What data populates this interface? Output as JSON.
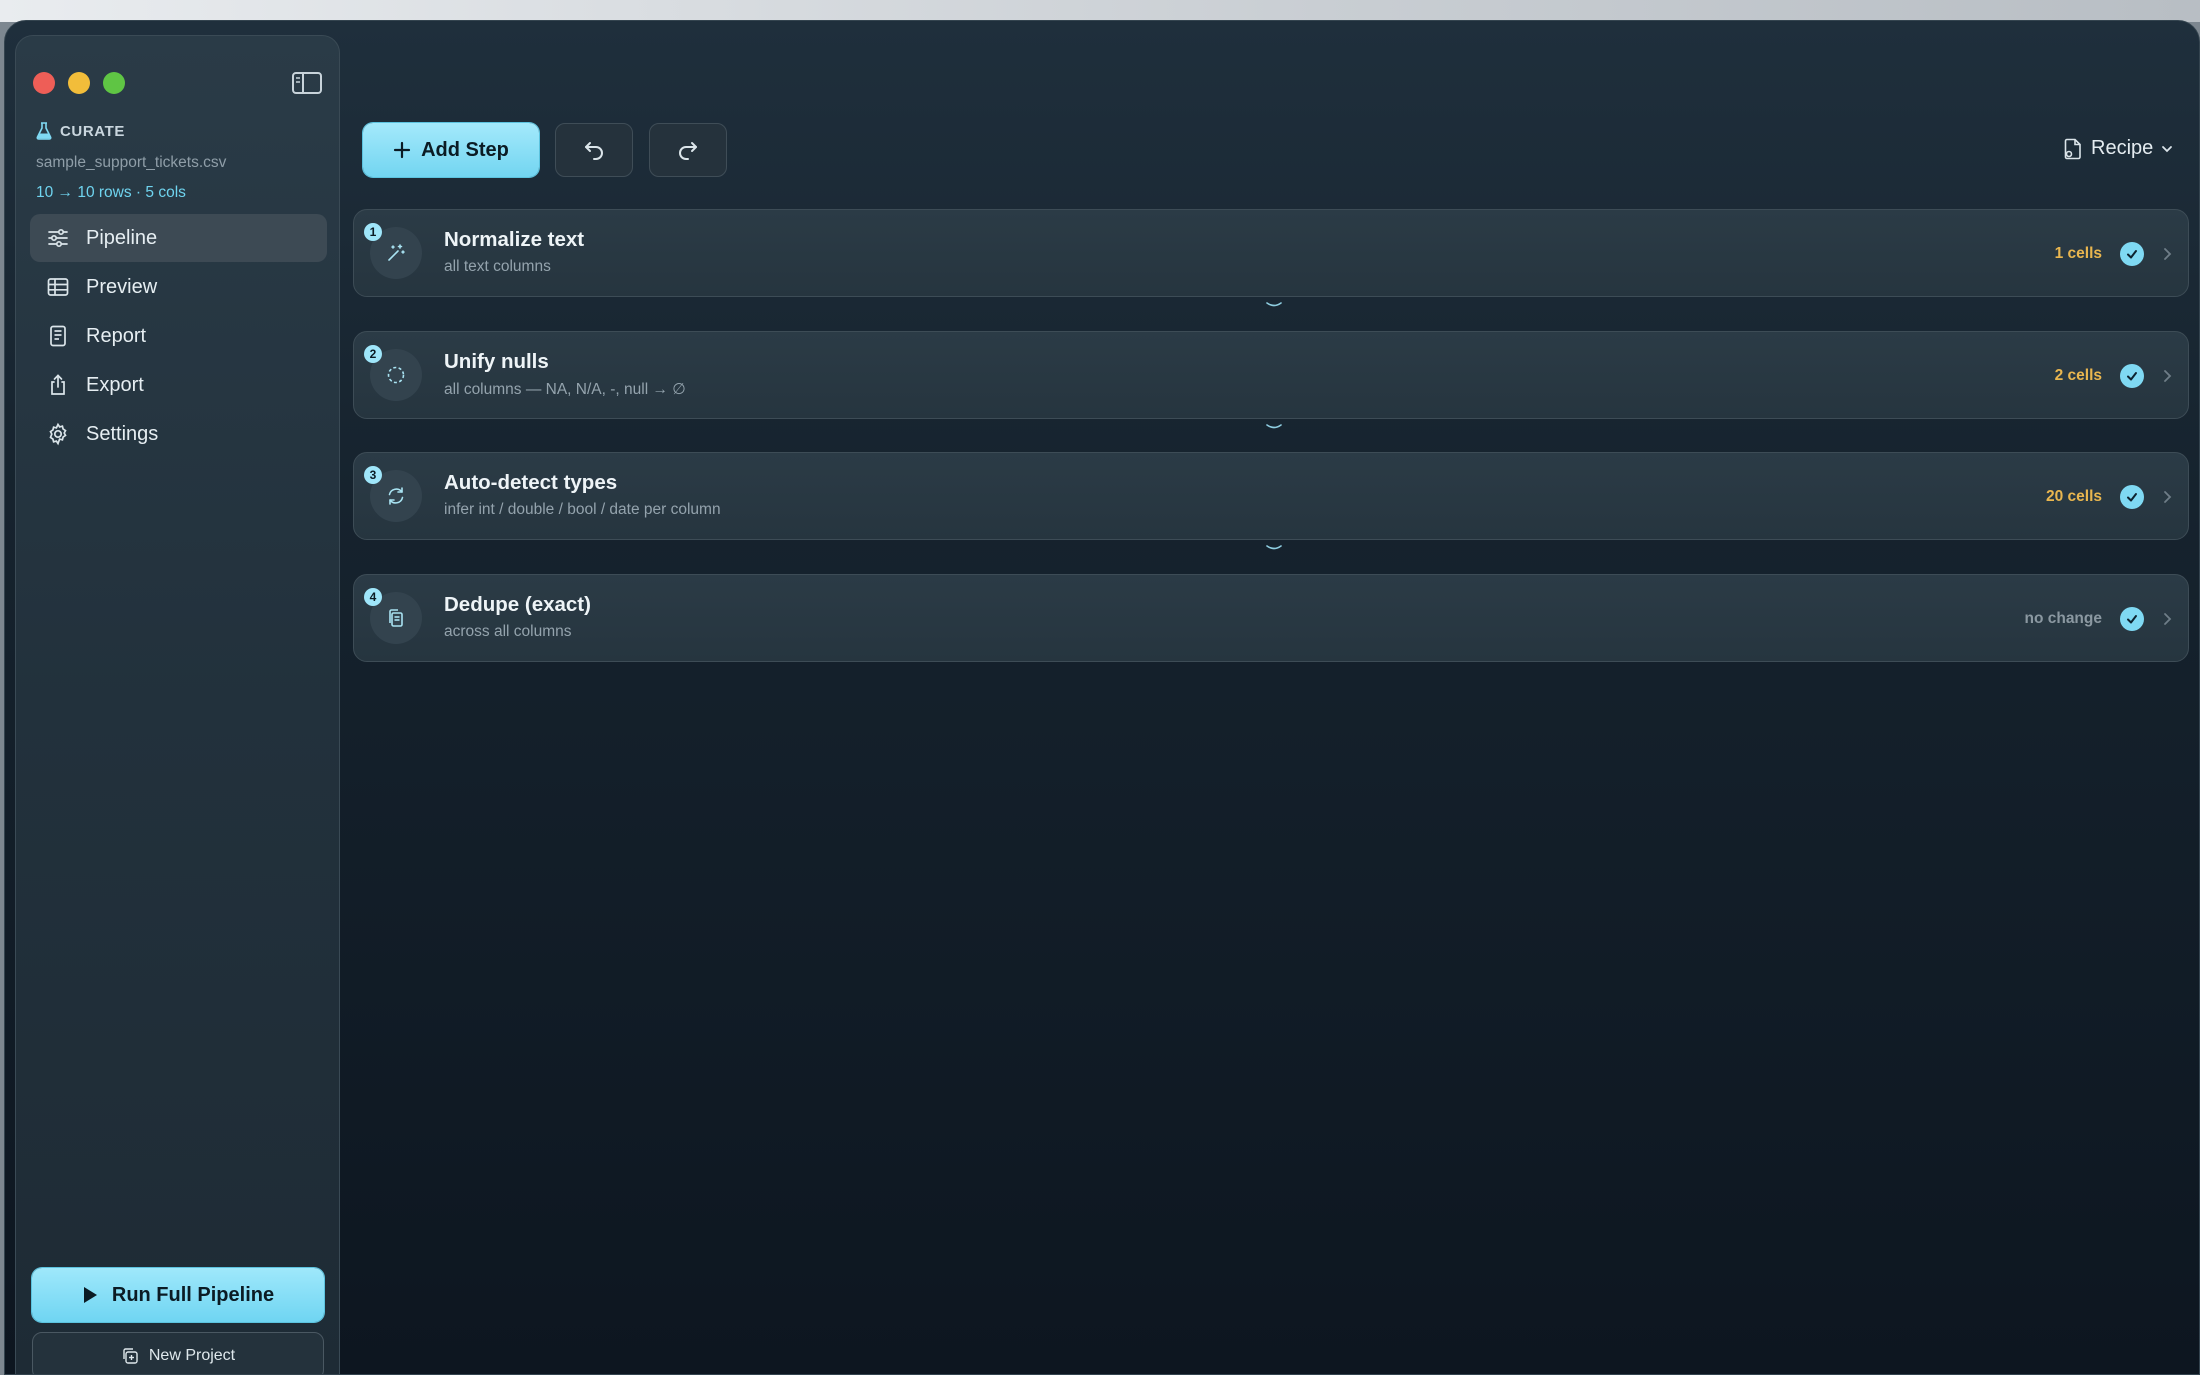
{
  "app": {
    "brand": "CURATE",
    "file_name": "sample_support_tickets.csv",
    "file_stats": "10 → 10 rows · 5 cols"
  },
  "sidebar": {
    "items": [
      {
        "label": "Pipeline",
        "icon": "sliders-icon",
        "active": true
      },
      {
        "label": "Preview",
        "icon": "table-icon",
        "active": false
      },
      {
        "label": "Report",
        "icon": "document-icon",
        "active": false
      },
      {
        "label": "Export",
        "icon": "share-icon",
        "active": false
      },
      {
        "label": "Settings",
        "icon": "gear-icon",
        "active": false
      }
    ],
    "run_label": "Run Full Pipeline",
    "new_project_label": "New Project"
  },
  "toolbar": {
    "add_step_label": "Add Step",
    "recipe_label": "Recipe"
  },
  "steps": [
    {
      "number": "1",
      "title": "Normalize text",
      "subtitle": "all text columns",
      "count": "1 cells",
      "icon": "wand-icon"
    },
    {
      "number": "2",
      "title": "Unify nulls",
      "subtitle": "all columns — NA, N/A, -, null → ∅",
      "count": "2 cells",
      "icon": "dashed-circle-icon"
    },
    {
      "number": "3",
      "title": "Auto-detect types",
      "subtitle": "infer int / double / bool / date per column",
      "count": "20 cells",
      "icon": "refresh-icon"
    },
    {
      "number": "4",
      "title": "Dedupe (exact)",
      "subtitle": "across all columns",
      "count": "no change",
      "icon": "copy-docs-icon"
    }
  ],
  "colors": {
    "accent": "#7fd9f3",
    "count_highlight": "#e9b64f",
    "background": "#16232e"
  }
}
